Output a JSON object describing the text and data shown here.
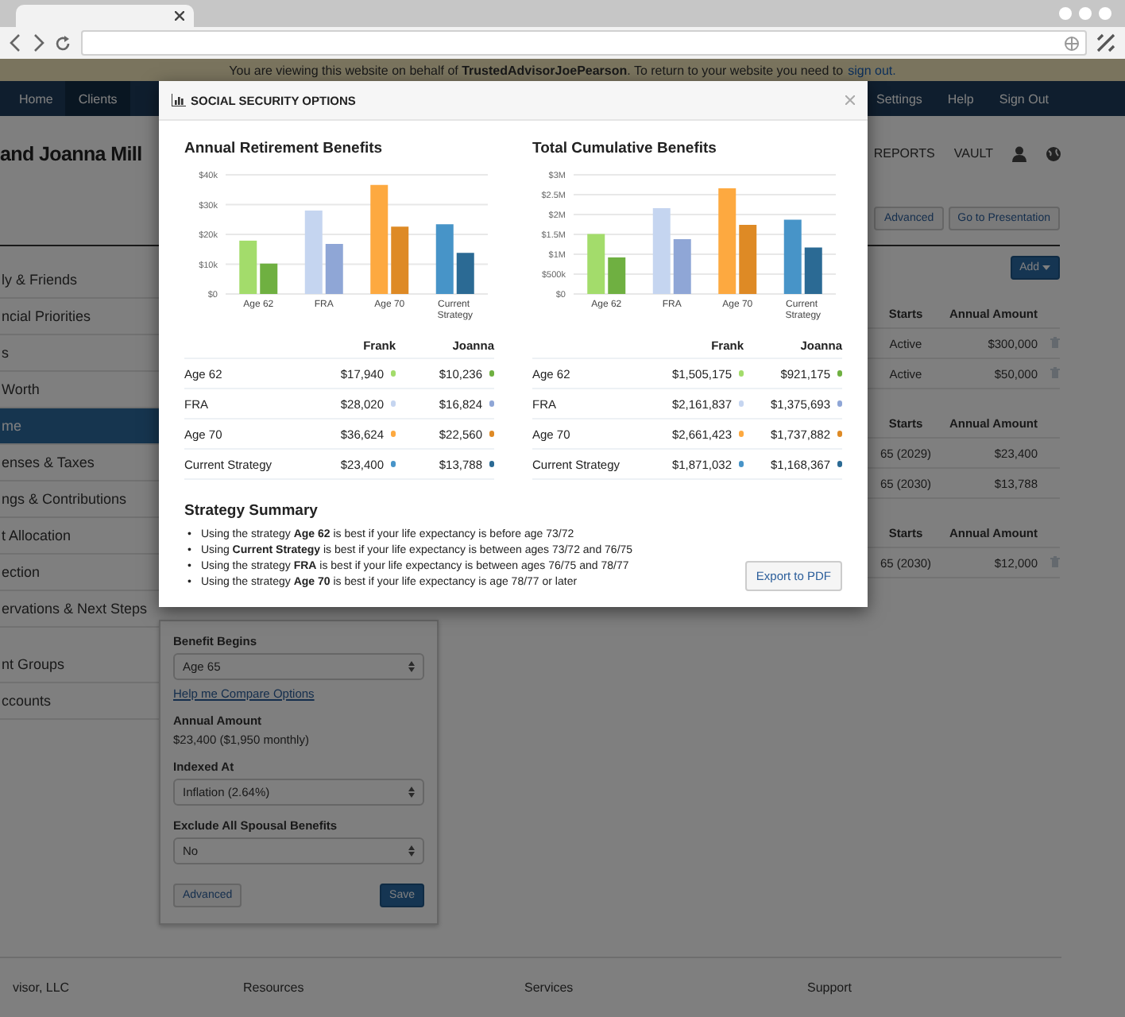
{
  "banner": {
    "text": "You are viewing this website on behalf of **TrustedAdvisorJoePearson**.  To return to your website you need to",
    "link": "sign out."
  },
  "nav": {
    "left": [
      {
        "label": "Home",
        "selected": false
      },
      {
        "label": "Clients",
        "selected": true
      }
    ],
    "right": [
      {
        "label": "Settings",
        "selected": false
      },
      {
        "label": "Help",
        "selected": false
      },
      {
        "label": "Sign Out",
        "selected": false
      }
    ]
  },
  "header": {
    "title": "and Joanna Mill",
    "links": [
      "REPORTS",
      "VAULT"
    ]
  },
  "toolbar_buttons": [
    "Advanced",
    "Go to Presentation"
  ],
  "sidebar": {
    "groups": [
      {
        "items": [
          {
            "label": "ly & Friends",
            "selected": false
          },
          {
            "label": "ncial Priorities",
            "selected": false
          },
          {
            "label": "s",
            "selected": false
          },
          {
            "label": "Worth",
            "selected": false
          },
          {
            "label": "me",
            "selected": true
          },
          {
            "label": "enses & Taxes",
            "selected": false
          },
          {
            "label": "ngs & Contributions",
            "selected": false
          },
          {
            "label": "t Allocation",
            "selected": false
          },
          {
            "label": "ection",
            "selected": false
          },
          {
            "label": "ervations & Next Steps",
            "selected": false
          }
        ]
      },
      {
        "items": [
          {
            "label": "nt Groups",
            "selected": false
          },
          {
            "label": "ccounts",
            "selected": false
          }
        ]
      }
    ]
  },
  "add_button": "Add",
  "tables": [
    {
      "columns": [
        "Starts",
        "Annual Amount"
      ],
      "rows": [
        {
          "starts": "Active",
          "amount": "$300,000",
          "deletable": true
        },
        {
          "starts": "Active",
          "amount": "$50,000",
          "deletable": true
        }
      ]
    },
    {
      "columns": [
        "Starts",
        "Annual Amount"
      ],
      "rows": [
        {
          "starts": "65 (2029)",
          "amount": "$23,400",
          "deletable": false
        },
        {
          "starts": "65 (2030)",
          "amount": "$13,788",
          "deletable": false
        }
      ]
    },
    {
      "columns": [
        "Starts",
        "Annual Amount"
      ],
      "rows": [
        {
          "starts": "65 (2030)",
          "amount": "$12,000",
          "deletable": true
        }
      ]
    }
  ],
  "form": {
    "fields": [
      {
        "kind": "select",
        "label": "Benefit Begins",
        "value": "Age 65"
      },
      {
        "kind": "link",
        "text": "Help me Compare Options"
      },
      {
        "kind": "readout",
        "label": "Annual Amount",
        "value": "$23,400 ($1,950 monthly)"
      },
      {
        "kind": "select",
        "label": "Indexed At",
        "value": "Inflation (2.64%)"
      },
      {
        "kind": "select",
        "label": "Exclude All Spousal Benefits",
        "value": "No"
      }
    ],
    "buttons": [
      {
        "label": "Advanced",
        "primary": false
      },
      {
        "label": "Save",
        "primary": true
      }
    ]
  },
  "footer": [
    "visor, LLC",
    "Resources",
    "Services",
    "Support"
  ],
  "modal": {
    "title": "SOCIAL SECURITY OPTIONS",
    "panels": [
      {
        "chart_data": {
          "type": "bar",
          "title": "Annual Retirement Benefits",
          "grid": true,
          "categories": [
            "Age 62",
            "FRA",
            "Age 70",
            "Current Strategy"
          ],
          "series": [
            {
              "name": "Frank",
              "colors": [
                "#a3dc6b",
                "#c5d5f0",
                "#fda940",
                "#4794c8"
              ],
              "values": [
                17900,
                28000,
                36600,
                23400
              ]
            },
            {
              "name": "Joanna",
              "colors": [
                "#6fb041",
                "#8fa6d6",
                "#de8a25",
                "#2b6a94"
              ],
              "values": [
                10200,
                16800,
                22600,
                13800
              ]
            }
          ],
          "ylim": [
            0,
            40000
          ],
          "yticks": [
            {
              "value": 0,
              "label": "$0"
            },
            {
              "value": 10000,
              "label": "$10k"
            },
            {
              "value": 20000,
              "label": "$20k"
            },
            {
              "value": 30000,
              "label": "$30k"
            },
            {
              "value": 40000,
              "label": "$40k"
            }
          ]
        },
        "rows": [
          {
            "label": "Age 62",
            "values": [
              {
                "text": "$17,940",
                "color": "#a3dc6b"
              },
              {
                "text": "$10,236",
                "color": "#6fb041"
              }
            ]
          },
          {
            "label": "FRA",
            "values": [
              {
                "text": "$28,020",
                "color": "#c5d5f0"
              },
              {
                "text": "$16,824",
                "color": "#8fa6d6"
              }
            ]
          },
          {
            "label": "Age 70",
            "values": [
              {
                "text": "$36,624",
                "color": "#fda940"
              },
              {
                "text": "$22,560",
                "color": "#de8a25"
              }
            ]
          },
          {
            "label": "Current Strategy",
            "values": [
              {
                "text": "$23,400",
                "color": "#4794c8"
              },
              {
                "text": "$13,788",
                "color": "#2b6a94"
              }
            ]
          }
        ]
      },
      {
        "chart_data": {
          "type": "bar",
          "title": "Total Cumulative Benefits",
          "grid": true,
          "categories": [
            "Age 62",
            "FRA",
            "Age 70",
            "Current Strategy"
          ],
          "series": [
            {
              "name": "Frank",
              "colors": [
                "#a3dc6b",
                "#c5d5f0",
                "#fda940",
                "#4794c8"
              ],
              "values": [
                1510000,
                2160000,
                2660000,
                1870000
              ]
            },
            {
              "name": "Joanna",
              "colors": [
                "#6fb041",
                "#8fa6d6",
                "#de8a25",
                "#2b6a94"
              ],
              "values": [
                920000,
                1380000,
                1740000,
                1170000
              ]
            }
          ],
          "ylim": [
            0,
            3000000
          ],
          "yticks": [
            {
              "value": 0,
              "label": "$0"
            },
            {
              "value": 500000,
              "label": "$500k"
            },
            {
              "value": 1000000,
              "label": "$1M"
            },
            {
              "value": 1500000,
              "label": "$1.5M"
            },
            {
              "value": 2000000,
              "label": "$2M"
            },
            {
              "value": 2500000,
              "label": "$2.5M"
            },
            {
              "value": 3000000,
              "label": "$3M"
            }
          ]
        },
        "rows": [
          {
            "label": "Age 62",
            "values": [
              {
                "text": "$1,505,175",
                "color": "#a3dc6b"
              },
              {
                "text": "$921,175",
                "color": "#6fb041"
              }
            ]
          },
          {
            "label": "FRA",
            "values": [
              {
                "text": "$2,161,837",
                "color": "#c5d5f0"
              },
              {
                "text": "$1,375,693",
                "color": "#8fa6d6"
              }
            ]
          },
          {
            "label": "Age 70",
            "values": [
              {
                "text": "$2,661,423",
                "color": "#fda940"
              },
              {
                "text": "$1,737,882",
                "color": "#de8a25"
              }
            ]
          },
          {
            "label": "Current Strategy",
            "values": [
              {
                "text": "$1,871,032",
                "color": "#4794c8"
              },
              {
                "text": "$1,168,367",
                "color": "#2b6a94"
              }
            ]
          }
        ]
      }
    ],
    "summary": {
      "title": "Strategy Summary",
      "items": [
        {
          "bullet": "•",
          "text": "Using the strategy **Age 62** is best if your life expectancy is before age 73/72"
        },
        {
          "bullet": "•",
          "text": "Using **Current Strategy** is best if your life expectancy is between ages 73/72 and 76/75"
        },
        {
          "bullet": "•",
          "text": "Using the strategy **FRA** is best if your life expectancy is between ages 76/75 and 78/77"
        },
        {
          "bullet": "•",
          "text": "Using the strategy **Age 70** is best if your life expectancy is age 78/77 or later"
        }
      ]
    },
    "export_button": "Export to PDF"
  }
}
